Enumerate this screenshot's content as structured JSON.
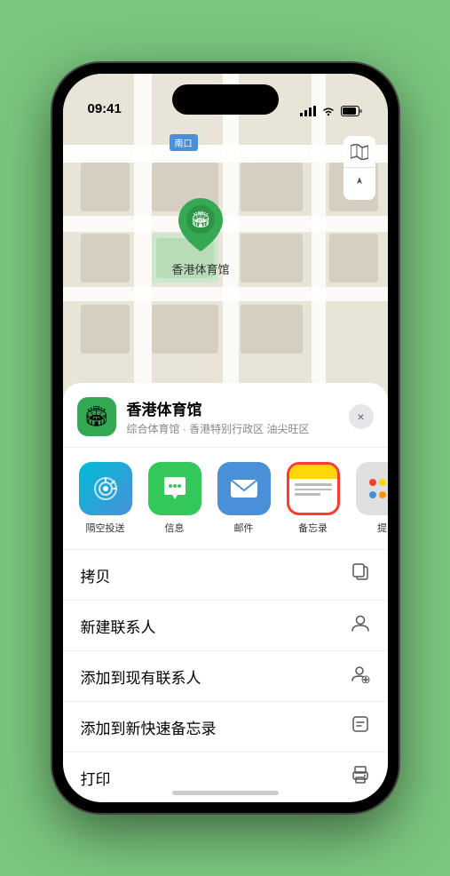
{
  "statusBar": {
    "time": "09:41",
    "timeIcon": "▶",
    "signal": "●●●●",
    "wifi": "wifi",
    "battery": "battery"
  },
  "mapLabel": "南口",
  "locationPin": {
    "label": "香港体育馆",
    "emoji": "🏟"
  },
  "mapControls": {
    "mapTypeIcon": "🗺",
    "locationIcon": "➤"
  },
  "venueHeader": {
    "icon": "🏟",
    "name": "香港体育馆",
    "subtitle": "综合体育馆 · 香港特别行政区 油尖旺区",
    "closeLabel": "×"
  },
  "shareItems": [
    {
      "id": "airdrop",
      "label": "隔空投送",
      "type": "airdrop"
    },
    {
      "id": "messages",
      "label": "信息",
      "type": "messages"
    },
    {
      "id": "mail",
      "label": "邮件",
      "type": "mail"
    },
    {
      "id": "notes",
      "label": "备忘录",
      "type": "notes"
    },
    {
      "id": "more",
      "label": "提",
      "type": "more"
    }
  ],
  "actionItems": [
    {
      "id": "copy",
      "label": "拷贝",
      "icon": "⎘"
    },
    {
      "id": "new-contact",
      "label": "新建联系人",
      "icon": "👤"
    },
    {
      "id": "add-existing",
      "label": "添加到现有联系人",
      "icon": "👤"
    },
    {
      "id": "add-notes",
      "label": "添加到新快速备忘录",
      "icon": "📝"
    },
    {
      "id": "print",
      "label": "打印",
      "icon": "🖨"
    }
  ]
}
